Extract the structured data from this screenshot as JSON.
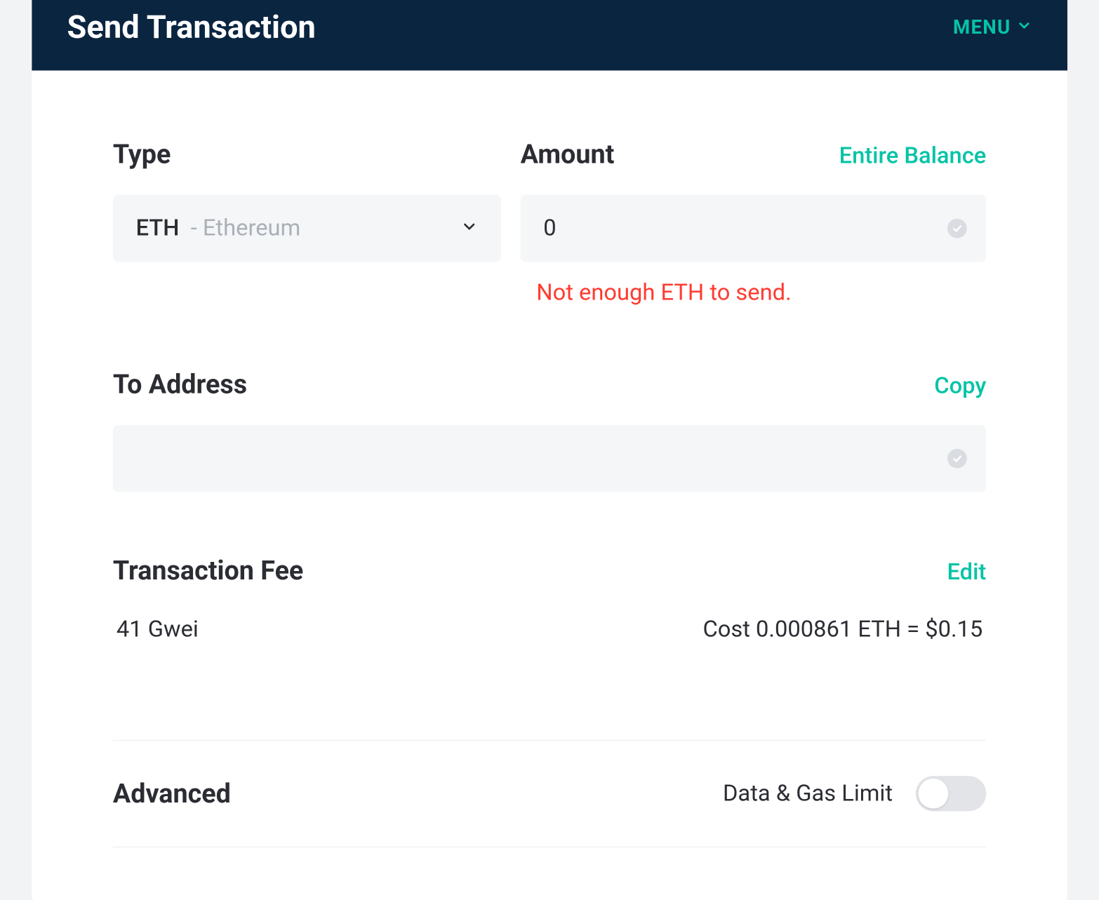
{
  "header": {
    "title": "Send Transaction",
    "menu_label": "MENU"
  },
  "type": {
    "label": "Type",
    "symbol": "ETH",
    "name": "Ethereum"
  },
  "amount": {
    "label": "Amount",
    "entire_balance_label": "Entire Balance",
    "value": "0",
    "error": "Not enough ETH to send."
  },
  "to_address": {
    "label": "To Address",
    "copy_label": "Copy",
    "value": ""
  },
  "fee": {
    "label": "Transaction Fee",
    "edit_label": "Edit",
    "gwei": "41 Gwei",
    "cost": "Cost 0.000861 ETH = $0.15"
  },
  "advanced": {
    "label": "Advanced",
    "toggle_label": "Data & Gas Limit",
    "toggle_on": false
  }
}
